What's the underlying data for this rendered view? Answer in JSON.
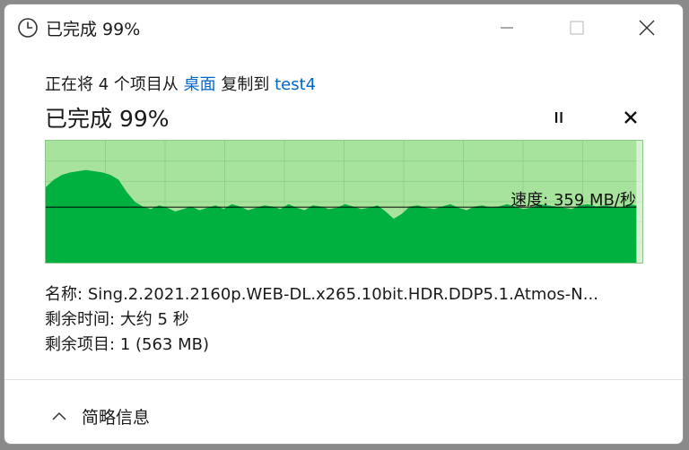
{
  "window": {
    "title": "已完成 99%",
    "icon": "clock-icon"
  },
  "copy_info": {
    "prefix": "正在将 4 个项目从 ",
    "source": "桌面",
    "middle": " 复制到 ",
    "destination": "test4"
  },
  "status": {
    "text": "已完成 99%",
    "progress_percent": 99,
    "pause_icon": "pause-icon",
    "cancel_icon": "close-icon"
  },
  "chart_data": {
    "type": "area",
    "progress_fraction": 0.99,
    "current_speed_label": "速度: 359 MB/秒",
    "current_speed_mb_s": 359,
    "colors": {
      "fill": "#00b140",
      "background": "#a8e39d",
      "grid": "#8fd38a"
    },
    "throughput_samples_relative": [
      0.62,
      0.68,
      0.72,
      0.74,
      0.75,
      0.76,
      0.75,
      0.74,
      0.72,
      0.68,
      0.58,
      0.5,
      0.46,
      0.44,
      0.47,
      0.45,
      0.42,
      0.44,
      0.46,
      0.43,
      0.45,
      0.47,
      0.44,
      0.48,
      0.46,
      0.43,
      0.45,
      0.47,
      0.46,
      0.44,
      0.48,
      0.45,
      0.43,
      0.47,
      0.46,
      0.44,
      0.45,
      0.48,
      0.46,
      0.44,
      0.45,
      0.47,
      0.42,
      0.36,
      0.4,
      0.46,
      0.47,
      0.45,
      0.44,
      0.46,
      0.48,
      0.45,
      0.43,
      0.46,
      0.47,
      0.45,
      0.46,
      0.48,
      0.46,
      0.44,
      0.45,
      0.48,
      0.47,
      0.46,
      0.45,
      0.44,
      0.47,
      0.48,
      0.46,
      0.47,
      0.46,
      0.45,
      0.48,
      0.47
    ]
  },
  "details": {
    "name_label": "名称:",
    "name_value": "Sing.2.2021.2160p.WEB-DL.x265.10bit.HDR.DDP5.1.Atmos-N...",
    "time_label": "剩余时间:",
    "time_value": "大约 5 秒",
    "items_label": "剩余项目:",
    "items_value": "1 (563 MB)"
  },
  "footer": {
    "toggle_label": "简略信息",
    "toggle_icon": "chevron-up-icon"
  }
}
